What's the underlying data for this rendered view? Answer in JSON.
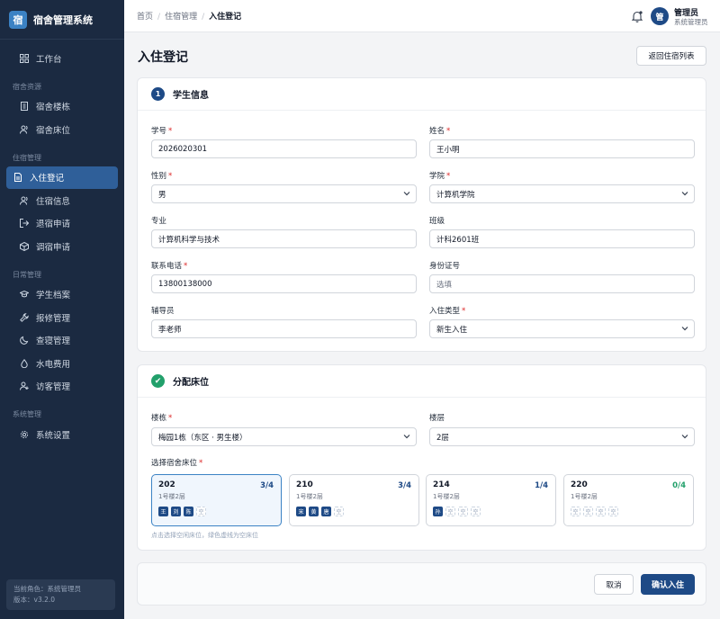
{
  "app": {
    "logo_char": "宿",
    "title": "宿舍管理系统"
  },
  "sidebar": {
    "dashboard": "工作台",
    "section_dorm": "宿舍资源",
    "dorm_items": [
      "宿舍楼栋",
      "宿舍床位"
    ],
    "section_stay": "住宿管理",
    "stay_items": [
      "入住登记",
      "住宿信息",
      "退宿申请",
      "调宿申请"
    ],
    "section_daily": "日常管理",
    "daily_items": [
      "学生档案",
      "报修管理",
      "查寝管理",
      "水电费用",
      "访客管理"
    ],
    "section_system": "系统管理",
    "system_items": [
      "系统设置"
    ],
    "role_line": "当前角色：系统管理员",
    "version_line": "版本：v3.2.0"
  },
  "header": {
    "breadcrumb": [
      "首页",
      "住宿管理",
      "入住登记"
    ],
    "sep": "/",
    "avatar_char": "管",
    "user_name": "管理员",
    "user_role": "系统管理员"
  },
  "page": {
    "title": "入住登记",
    "back_label": "返回住宿列表"
  },
  "student": {
    "num": "1",
    "title": "学生信息",
    "id_label": "学号",
    "id_value": "2026020301",
    "name_label": "姓名",
    "name_value": "王小明",
    "gender_label": "性别",
    "gender_value": "男",
    "college_label": "学院",
    "college_value": "计算机学院",
    "major_label": "专业",
    "major_value": "计算机科学与技术",
    "class_label": "班级",
    "class_value": "计科2601班",
    "phone_label": "联系电话",
    "phone_value": "13800138000",
    "idcard_label": "身份证号",
    "idcard_placeholder": "选填",
    "tutor_label": "辅导员",
    "tutor_value": "李老师",
    "type_label": "入住类型",
    "type_value": "新生入住",
    "required_mark": "*"
  },
  "bed": {
    "check": "✔",
    "title": "分配床位",
    "building_label": "楼栋",
    "building_value": "梅园1栋（东区 · 男生楼）",
    "floor_label": "楼层",
    "floor_value": "2层",
    "select_label": "选择宿舍床位",
    "rooms": [
      {
        "no": "202",
        "count": "3/4",
        "sub": "1号楼2层",
        "slots": [
          "王",
          "刘",
          "陈",
          "空"
        ]
      },
      {
        "no": "210",
        "count": "3/4",
        "sub": "1号楼2层",
        "slots": [
          "宋",
          "黄",
          "唐",
          "空"
        ]
      },
      {
        "no": "214",
        "count": "1/4",
        "sub": "1号楼2层",
        "slots": [
          "孙",
          "空",
          "空",
          "空"
        ]
      },
      {
        "no": "220",
        "count": "0/4",
        "sub": "1号楼2层",
        "slots": [
          "空",
          "空",
          "空",
          "空"
        ]
      }
    ],
    "hint": "点击选择空闲床位，绿色虚线为空床位"
  },
  "actions": {
    "cancel": "取消",
    "confirm": "确认入住"
  },
  "colors": {
    "sidebar": "#1b2a41",
    "primary": "#1e4a86",
    "active_nav": "#2f5f99",
    "success": "#22a06b",
    "required": "#dc2626"
  }
}
